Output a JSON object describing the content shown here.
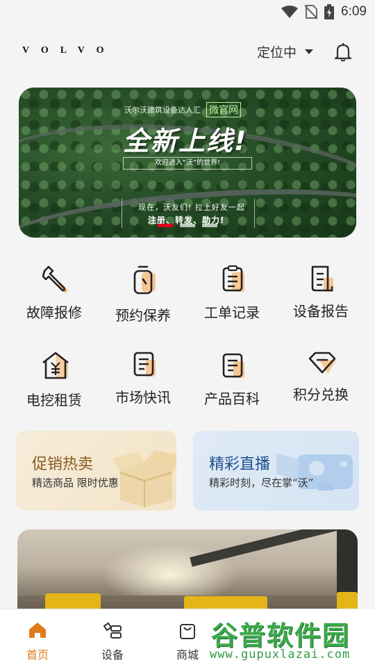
{
  "status_bar": {
    "time": "6:09",
    "icons": [
      "wifi-icon",
      "no-sim-icon",
      "battery-icon"
    ]
  },
  "header": {
    "logo": "VOLVO",
    "location": "定位中",
    "icons": [
      "chevron-down-icon",
      "bell-icon"
    ]
  },
  "banner": {
    "subtitle": "沃尔沃建筑设备达人汇",
    "tag": "微官网",
    "headline": "全新上线!",
    "welcome": "欢迎进入“沃”的世界!",
    "line1": "现在，沃友们! 拉上好友一起",
    "line2": "注册、转发、助力!",
    "slides": 3,
    "active_slide": 1
  },
  "menu": [
    {
      "label": "故障报修",
      "icon": "wrench-icon"
    },
    {
      "label": "预约保养",
      "icon": "stopwatch-icon"
    },
    {
      "label": "工单记录",
      "icon": "clipboard-icon"
    },
    {
      "label": "设备报告",
      "icon": "report-icon"
    },
    {
      "label": "电挖租赁",
      "icon": "rental-house-icon"
    },
    {
      "label": "市场快讯",
      "icon": "news-icon"
    },
    {
      "label": "产品百科",
      "icon": "book-icon"
    },
    {
      "label": "积分兑换",
      "icon": "diamond-icon"
    }
  ],
  "cards": {
    "promo": {
      "title": "促销热卖",
      "subtitle": "精选商品 限时优惠"
    },
    "live": {
      "title": "精彩直播",
      "subtitle": "精彩时刻，尽在掌“沃”"
    }
  },
  "tabbar": [
    {
      "label": "首页",
      "icon": "home-icon",
      "active": true
    },
    {
      "label": "设备",
      "icon": "equipment-icon",
      "active": false
    },
    {
      "label": "商城",
      "icon": "shopping-bag-icon",
      "active": false
    }
  ],
  "watermark": {
    "title": "谷普软件园",
    "url": "www.gupuxlazai.com"
  },
  "colors": {
    "accent": "#e07a1b",
    "banner_indicator": "#e0001b",
    "promo_title": "#8a5a1f",
    "live_title": "#1d4f8f"
  }
}
